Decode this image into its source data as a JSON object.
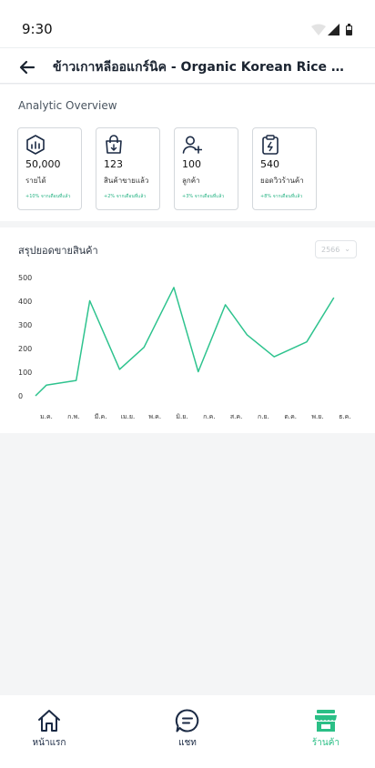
{
  "status_bar": {
    "time": "9:30"
  },
  "header": {
    "title": "ข้าวเกาหลีออแกร์นิค - Organic Korean Rice -  6 p..."
  },
  "overview": {
    "title": "Analytic Overview",
    "cards": [
      {
        "icon": "revenue-icon",
        "value": "50,000",
        "label": "รายได้",
        "trend": "+10% จากเดือนที่แล้ว"
      },
      {
        "icon": "shopping-bag-icon",
        "value": "123",
        "label": "สินค้าขายแล้ว",
        "trend": "+2% จากเดือนที่แล้ว"
      },
      {
        "icon": "add-user-icon",
        "value": "100",
        "label": "ลูกค้า",
        "trend": "+3% จากเดือนที่แล้ว"
      },
      {
        "icon": "clipboard-icon",
        "value": "540",
        "label": "ยอดวิวร้านค้า",
        "trend": "+8% จากเดือนที่แล้ว"
      }
    ]
  },
  "sales": {
    "title": "สรุปยอดขายสินค้า",
    "year_select": "2566"
  },
  "colors": {
    "accent": "#2bbf86",
    "line": "#2ec38e",
    "nav_text": "#1b2a44"
  },
  "chart_data": {
    "type": "line",
    "categories": [
      "ม.ค.",
      "ก.พ.",
      "มี.ค.",
      "เม.ย.",
      "พ.ค.",
      "มิ.ย.",
      "ก.ค.",
      "ส.ค.",
      "ก.ย.",
      "ต.ค.",
      "พ.ย.",
      "ธ.ค."
    ],
    "y_ticks": [
      0,
      100,
      200,
      300,
      400,
      500
    ],
    "ylim": [
      0,
      500
    ],
    "grid": false,
    "series": [
      {
        "x": [
          0,
          0.4,
          1.5,
          2.0,
          3.1,
          4.0,
          5.1,
          6.0,
          7.0,
          7.8,
          8.8,
          10.0,
          11.0
        ],
        "values": [
          0,
          45,
          65,
          402,
          112,
          205,
          458,
          102,
          385,
          258,
          165,
          228,
          415
        ]
      }
    ]
  },
  "bottom_nav": {
    "items": [
      {
        "icon": "home-icon",
        "label": "หน้าแรก"
      },
      {
        "icon": "chat-icon",
        "label": "แชท"
      },
      {
        "icon": "store-icon",
        "label": "ร้านค้า"
      }
    ]
  }
}
